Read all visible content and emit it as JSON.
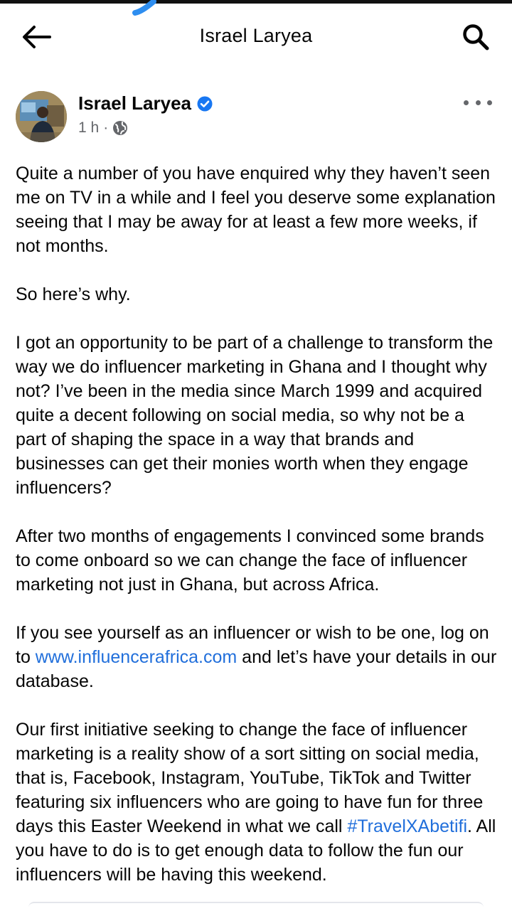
{
  "colors": {
    "text": "#050505",
    "meta": "#65676b",
    "link": "#216fdb",
    "verified": "#1877f2"
  },
  "header": {
    "title": "Israel Laryea",
    "back_icon": "arrow-left-icon",
    "search_icon": "search-icon"
  },
  "post": {
    "author": "Israel Laryea",
    "verified_icon": "verified-badge-icon",
    "time": "1 h",
    "separator": "·",
    "audience_icon": "globe-icon",
    "more_icon": "more-horizontal-icon",
    "p1": "Quite a number of you have enquired why they haven’t seen me on TV in a while and I feel you deserve some explanation seeing that I may be away for at least a few more weeks, if not months.",
    "p2": "So here’s why.",
    "p3": "I got an opportunity to be part of a challenge to transform the way we do influencer marketing in Ghana and I thought why not? I’ve been in the media since March 1999 and acquired quite a decent following on social media, so why not be a part of shaping the space in a way that brands and businesses can get their monies worth when they engage influencers?",
    "p4": "After two months of engagements I convinced some brands to come onboard so we can change the face of influencer marketing not just in Ghana, but across Africa.",
    "p5_before": "If you see yourself as an influencer or wish to be one, log on to ",
    "p5_link": "www.influencerafrica.com",
    "p5_after": " and let’s have your details in our database.",
    "p6_before": "Our first initiative seeking to change the face of influencer marketing is a reality show of a sort sitting on social media, that is, Facebook, Instagram, YouTube, TikTok and Twitter featuring six influencers who are going to have fun for three days this Easter Weekend in what we call ",
    "p6_hashtag": "#TravelXAbetifi",
    "p6_after": ". All you have to do is to get enough data to follow the fun our influencers will be having this weekend."
  }
}
